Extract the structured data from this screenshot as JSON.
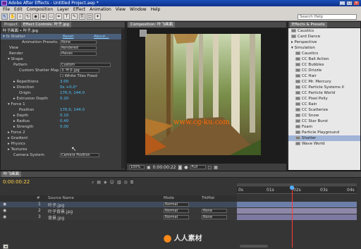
{
  "window": {
    "title": "Adobe After Effects - Untitled Project.aep *"
  },
  "menu": [
    "File",
    "Edit",
    "Composition",
    "Layer",
    "Effect",
    "Animation",
    "View",
    "Window",
    "Help"
  ],
  "search": {
    "placeholder": "Search Help"
  },
  "left_panel": {
    "tabs": [
      "Project",
      "Effect Controls: 叶子.jpg"
    ],
    "header": "叶子画面 • 叶子.jpg",
    "effect_name": "Shatter",
    "reset": "Reset",
    "about": "About...",
    "rows": [
      {
        "label": "View",
        "value": "Rendered"
      },
      {
        "label": "Render",
        "value": "Pieces"
      },
      {
        "label": "Shape",
        "value": ""
      },
      {
        "label": "Pattern",
        "value": "Custom"
      },
      {
        "label": "Custom Shatter Map",
        "value": "3. 叶子.jpg"
      },
      {
        "label": "",
        "value": "White Tiles Fixed"
      },
      {
        "label": "Repetitions",
        "value": "3.00"
      },
      {
        "label": "Direction",
        "value": "0x +0.0°"
      },
      {
        "label": "Origin",
        "value": "176.0, 144.0"
      },
      {
        "label": "Extrusion Depth",
        "value": "0.20"
      },
      {
        "label": "Force 1",
        "value": ""
      },
      {
        "label": "Position",
        "value": "176.0, 144.0"
      },
      {
        "label": "Depth",
        "value": "0.10"
      },
      {
        "label": "Radius",
        "value": "0.40"
      },
      {
        "label": "Strength",
        "value": "5.00"
      },
      {
        "label": "Force 2",
        "value": ""
      },
      {
        "label": "Gradient",
        "value": ""
      },
      {
        "label": "Physics",
        "value": ""
      },
      {
        "label": "Textures",
        "value": ""
      },
      {
        "label": "Camera System",
        "value": "Camera Position"
      }
    ]
  },
  "comp_panel": {
    "tab": "Composition: 叶飞画面",
    "zoom": "100%",
    "timecode": "0:00:00:22",
    "resolution": "Full",
    "watermark": "www.cg-ku.com"
  },
  "effects_panel": {
    "tab": "Effects & Presets",
    "items": [
      "Perspective",
      "Simulation",
      "CC Ball Action",
      "CC Bubbles",
      "CC Drizzle",
      "CC Hair",
      "CC Mr. Mercury",
      "CC Particle Systems II",
      "CC Particle World",
      "CC Pixel Polly",
      "CC Rain",
      "CC Scatterize",
      "CC Snow",
      "CC Star Burst",
      "Foam",
      "Particle Playground",
      "Shatter",
      "Wave World"
    ],
    "top_items": [
      "Caustics",
      "Card Dance",
      "CC Ball Action"
    ]
  },
  "timeline": {
    "tab": "叶飞画面",
    "timecode": "0:00:00:22",
    "columns": {
      "num": "#",
      "source": "Source Name",
      "mode": "Mode",
      "trkmat": "TrkMat"
    },
    "layers": [
      {
        "num": "1",
        "name": "叶子.jpg",
        "mode": "Normal",
        "trkmat": ""
      },
      {
        "num": "2",
        "name": "叶子背景.jpg",
        "mode": "Normal",
        "trkmat": "None"
      },
      {
        "num": "3",
        "name": "背景.jpg",
        "mode": "Normal",
        "trkmat": "None"
      }
    ],
    "ruler_labels": [
      "0s",
      "01s",
      "02s",
      "03s",
      "04s"
    ],
    "playhead_fraction": 0.46
  },
  "logo_text": "人人素材"
}
